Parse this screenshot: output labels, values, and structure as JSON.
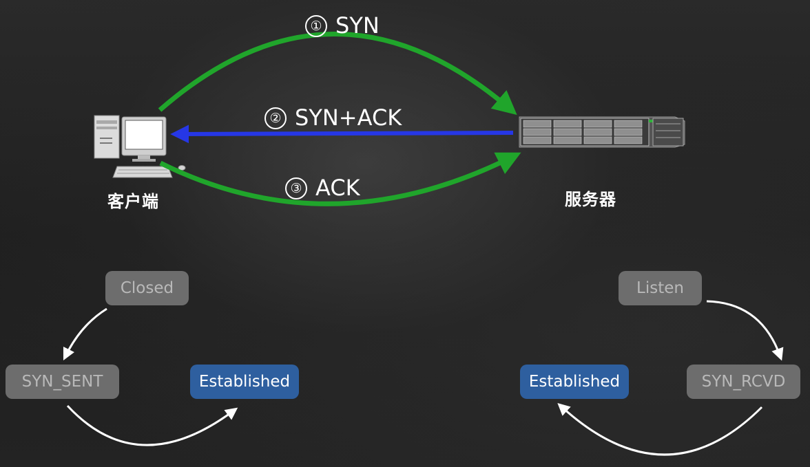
{
  "hosts": {
    "client_label": "客户端",
    "server_label": "服务器"
  },
  "messages": [
    {
      "number": "①",
      "text": "SYN",
      "color": "#20a52b"
    },
    {
      "number": "②",
      "text": "SYN+ACK",
      "color": "#2637e6"
    },
    {
      "number": "③",
      "text": "ACK",
      "color": "#20a52b"
    }
  ],
  "client_states": {
    "closed": "Closed",
    "syn_sent": "SYN_SENT",
    "established": "Established"
  },
  "server_states": {
    "listen": "Listen",
    "syn_rcvd": "SYN_RCVD",
    "established": "Established"
  },
  "colors": {
    "state_gray_bg": "#6d6d6d",
    "state_gray_text": "#b9b9b9",
    "state_established_bg": "#2e5f9f",
    "arrow_green": "#20a52b",
    "arrow_blue": "#2637e6",
    "transition_arrow": "#ffffff"
  },
  "icons": {
    "client": "desktop-computer-icon",
    "server": "rack-server-icon"
  }
}
